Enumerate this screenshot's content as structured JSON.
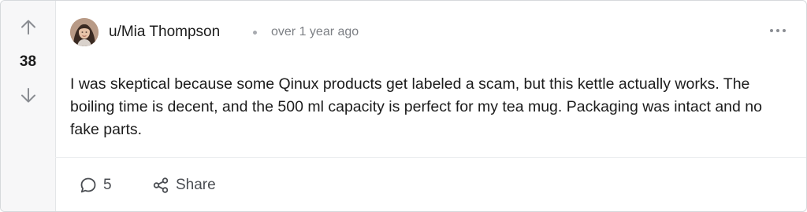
{
  "post": {
    "vote_count": "38",
    "author": "u/Mia Thompson",
    "timestamp": "over 1 year ago",
    "body": "I was skeptical because some Qinux products get labeled a scam, but this kettle actually works. The boiling time is decent, and the 500 ml capacity is perfect for my tea mug. Packaging was intact and no fake parts.",
    "comment_count": "5",
    "share_label": "Share"
  },
  "icons": {
    "upvote": "arrow-up-icon",
    "downvote": "arrow-down-icon",
    "more": "more-horizontal-icon",
    "comment": "comment-bubble-icon",
    "share": "share-icon"
  },
  "colors": {
    "text": "#1c1c1c",
    "muted": "#7c7f84",
    "icon": "#8a8d92",
    "rail_bg": "#f7f7f8",
    "border": "#d6d9dc"
  }
}
